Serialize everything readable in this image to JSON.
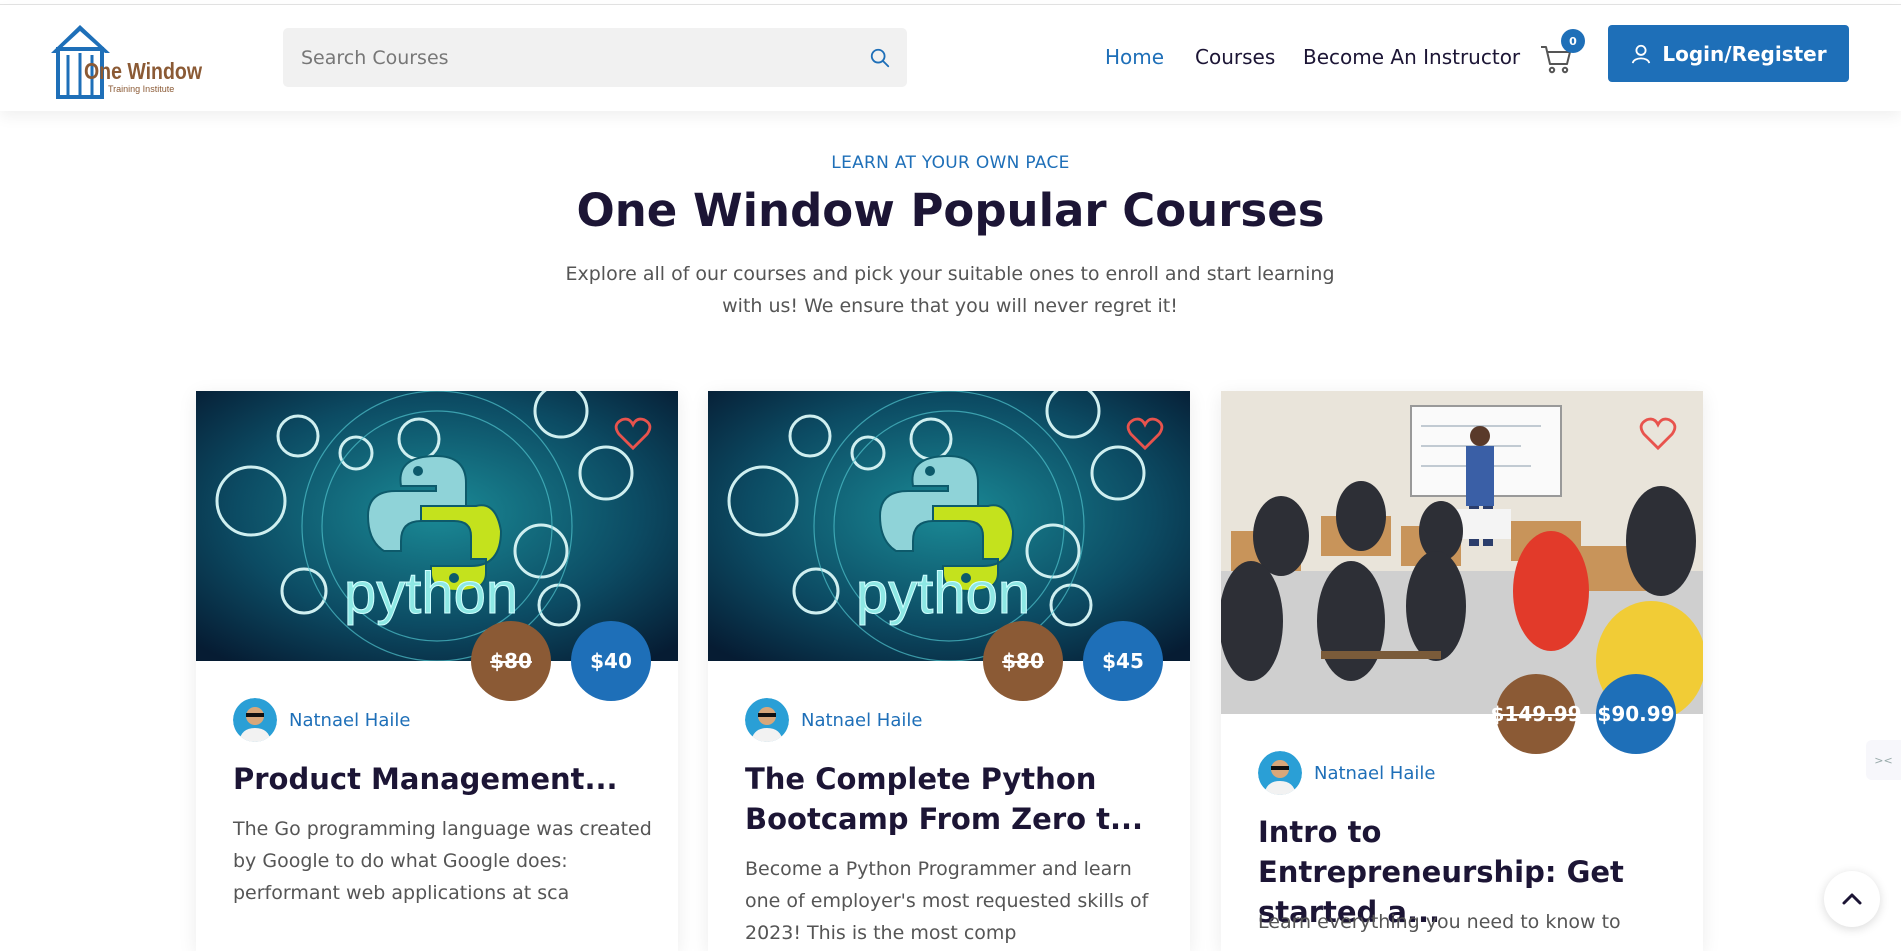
{
  "header": {
    "logo_text": "One Window",
    "logo_subtext": "Training Institute",
    "search_placeholder": "Search Courses",
    "nav": [
      {
        "label": "Home",
        "active": true
      },
      {
        "label": "Courses",
        "active": false
      },
      {
        "label": "Become An Instructor",
        "active": false
      }
    ],
    "cart_count": "0",
    "login_label": "Login/Register"
  },
  "section": {
    "eyebrow": "LEARN AT YOUR OWN PACE",
    "title": "One Window Popular Courses",
    "description": "Explore all of our courses and pick your suitable ones to enroll and start learning with us! We ensure that you will never regret it!"
  },
  "courses": [
    {
      "image": "python-banner",
      "old_price": "$80",
      "price": "$40",
      "instructor": "Natnael Haile",
      "title": "Product Management...",
      "description": "The Go programming language was created by Google to do what Google does: performant web applications at sca"
    },
    {
      "image": "python-banner",
      "old_price": "$80",
      "price": "$45",
      "instructor": "Natnael Haile",
      "title": "The Complete Python Bootcamp From Zero t...",
      "description": "Become a Python Programmer and learn one of employer's most requested skills of 2023! This is the most comp"
    },
    {
      "image": "classroom-photo",
      "old_price": "$149.99",
      "price": "$90.99",
      "instructor": "Natnael Haile",
      "title": "Intro to Entrepreneurship: Get started a...",
      "description": "Learn everything you need to know to"
    }
  ],
  "colors": {
    "brand_blue": "#1e6fb8",
    "old_price_brown": "#8b5a35",
    "heading": "#1c1535",
    "heart": "#e8534d"
  },
  "icons": [
    "search-icon",
    "cart-icon",
    "user-icon",
    "heart-icon",
    "chevron-up-icon"
  ]
}
